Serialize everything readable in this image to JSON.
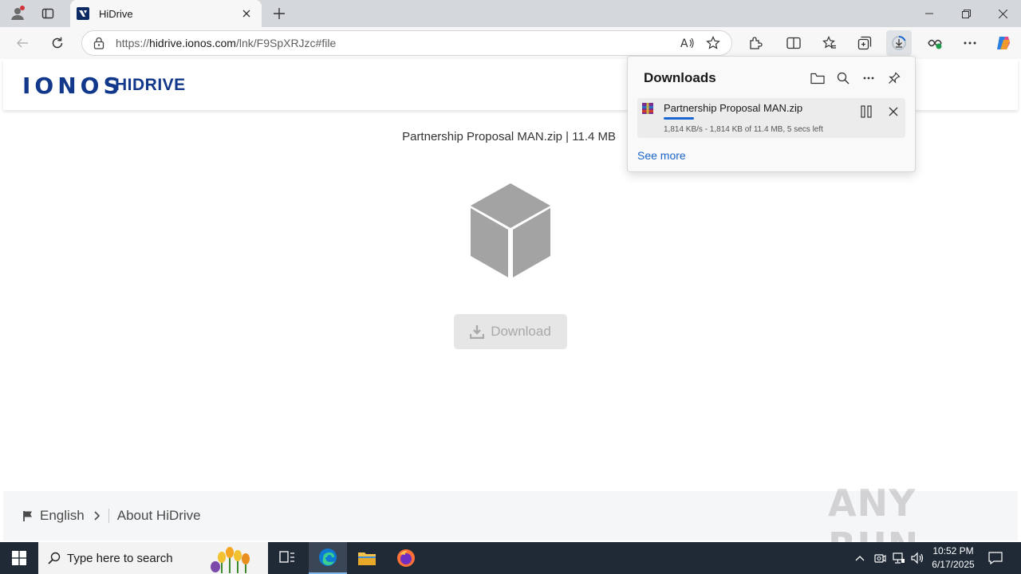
{
  "browser": {
    "tab_title": "HiDrive",
    "url_prefix": "https://",
    "url_host": "hidrive.ionos.com",
    "url_path": "/lnk/F9SpXRJzc#file"
  },
  "site": {
    "logo_primary": "IONOS",
    "logo_secondary": "HIDRIVE",
    "file_info": "Partnership Proposal MAN.zip | 11.4 MB",
    "download_button": "Download",
    "footer_language": "English",
    "footer_about": "About HiDrive",
    "watermark": "ANY RUN"
  },
  "downloads_panel": {
    "title": "Downloads",
    "item": {
      "file_name": "Partnership Proposal MAN.zip",
      "status": "1,814 KB/s - 1,814 KB of 11.4 MB, 5 secs left",
      "progress": 0.16
    },
    "see_more": "See more"
  },
  "taskbar": {
    "search_placeholder": "Type here to search",
    "time": "10:52 PM",
    "date": "6/17/2025"
  }
}
